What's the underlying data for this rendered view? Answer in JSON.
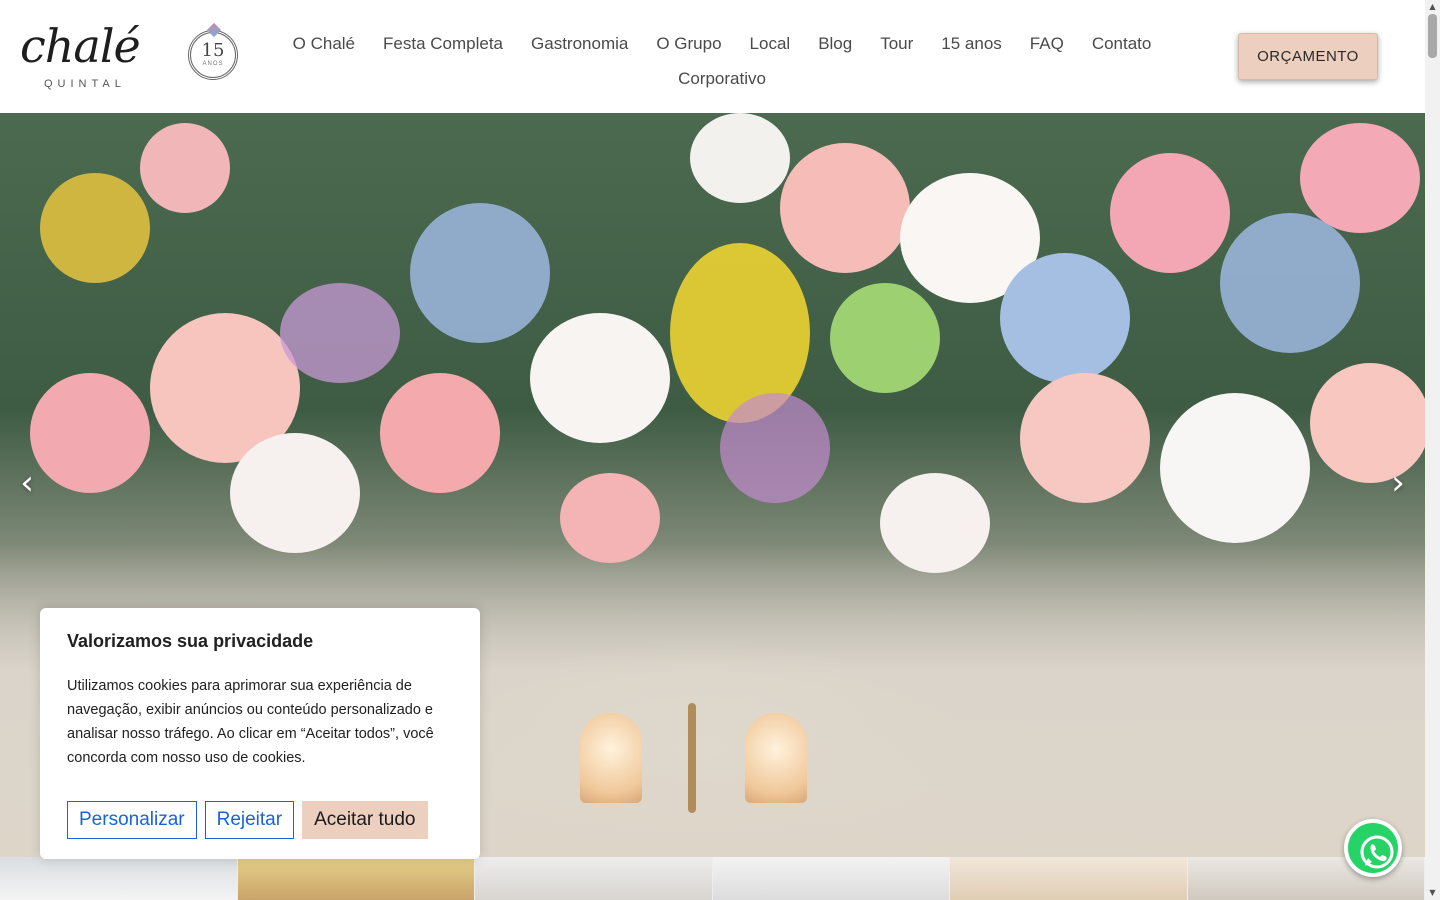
{
  "brand": {
    "logo_script": "chalé",
    "logo_sub": "QUINTAL",
    "badge_number": "15",
    "badge_sub": "ANOS"
  },
  "nav": {
    "row1": [
      "O Chalé",
      "Festa Completa",
      "Gastronomia",
      "O Grupo",
      "Local",
      "Blog",
      "Tour",
      "15 anos",
      "FAQ",
      "Contato"
    ],
    "row2": [
      "Corporativo"
    ]
  },
  "cta": {
    "label": "ORÇAMENTO"
  },
  "hero": {
    "prev_icon": "chevron-left-icon",
    "next_icon": "chevron-right-icon",
    "prev_glyph": "‹",
    "next_glyph": "›"
  },
  "cookie": {
    "title": "Valorizamos sua privacidade",
    "body": "Utilizamos cookies para aprimorar sua experiência de navegação, exibir anúncios ou conteúdo personalizado e analisar nosso tráfego. Ao clicar em “Aceitar todos”, você concorda com nosso uso de cookies.",
    "customize_label": "Personalizar",
    "reject_label": "Rejeitar",
    "accept_label": "Aceitar tudo"
  },
  "colors": {
    "accent": "#eccfbe",
    "link_blue": "#1863dc",
    "whatsapp": "#25d366"
  }
}
